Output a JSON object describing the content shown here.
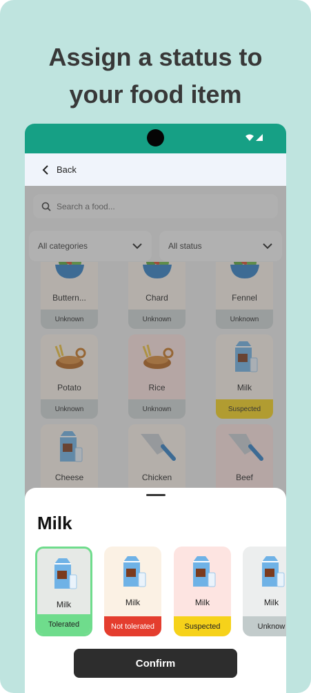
{
  "headline": {
    "line1": "Assign a status to",
    "line2": "your food item"
  },
  "appbar": {
    "back_label": "Back"
  },
  "search": {
    "placeholder": "Search a food..."
  },
  "filters": {
    "category": "All categories",
    "status": "All status"
  },
  "foods": [
    {
      "name": "Buttern...",
      "status": "Unknown",
      "status_color": "#cfd6d6",
      "bg": "#fbf3ea"
    },
    {
      "name": "Chard",
      "status": "Unknown",
      "status_color": "#cfd6d6",
      "bg": "#fbf3ea"
    },
    {
      "name": "Fennel",
      "status": "Unknown",
      "status_color": "#cfd6d6",
      "bg": "#fbf3ea"
    },
    {
      "name": "Potato",
      "status": "Unknown",
      "status_color": "#cfd6d6",
      "bg": "#fbf3ea"
    },
    {
      "name": "Rice",
      "status": "Unknown",
      "status_color": "#cfd6d6",
      "bg": "#fde4e1"
    },
    {
      "name": "Milk",
      "status": "Suspected",
      "status_color": "#f6d21a",
      "bg": "#fbf3ea"
    },
    {
      "name": "Cheese",
      "status": "",
      "status_color": "#e43d2e",
      "bg": "#fbf3ea"
    },
    {
      "name": "Chicken",
      "status": "",
      "status_color": "#f6d21a",
      "bg": "#fbf3ea"
    },
    {
      "name": "Beef",
      "status": "",
      "status_color": "#fbf3ea",
      "bg": "#fde4e1"
    }
  ],
  "sheet": {
    "title": "Milk",
    "options": [
      {
        "name": "Milk",
        "status": "Tolerated",
        "badge_color": "#6fdc8c",
        "bg": "#e6e9e6",
        "text_color": "#222222"
      },
      {
        "name": "Milk",
        "status": "Not tolerated",
        "badge_color": "#e43d2e",
        "bg": "#fbf1e4",
        "text_color": "#ffffff"
      },
      {
        "name": "Milk",
        "status": "Suspected",
        "badge_color": "#f6d21a",
        "bg": "#fde4e1",
        "text_color": "#222222"
      },
      {
        "name": "Milk",
        "status": "Unknow",
        "badge_color": "#c2cbcb",
        "bg": "#eceeee",
        "text_color": "#222222"
      }
    ],
    "confirm_label": "Confirm"
  },
  "colors": {
    "background": "#bfe4df",
    "status_bar": "#16a085",
    "app_bar": "#f0f4fb"
  },
  "icons": {
    "back": "chevron-left-icon",
    "search": "search-icon",
    "dropdown": "chevron-down-icon",
    "wifi": "wifi-icon",
    "signal": "signal-icon"
  }
}
